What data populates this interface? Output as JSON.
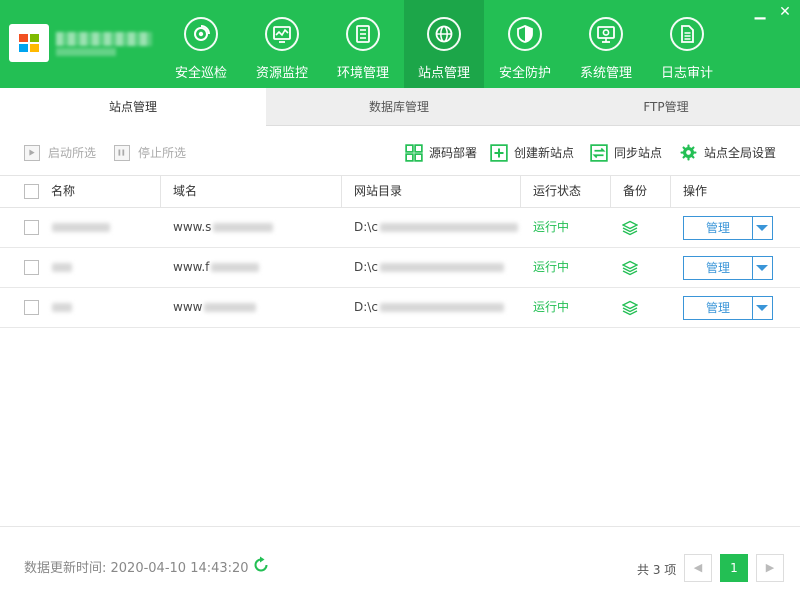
{
  "header": {
    "nav": [
      {
        "label": "安全巡检",
        "icon": "scan-icon"
      },
      {
        "label": "资源监控",
        "icon": "monitor-icon"
      },
      {
        "label": "环境管理",
        "icon": "server-icon"
      },
      {
        "label": "站点管理",
        "icon": "globe-icon",
        "active": true
      },
      {
        "label": "安全防护",
        "icon": "shield-icon"
      },
      {
        "label": "系统管理",
        "icon": "gear-screen-icon"
      },
      {
        "label": "日志审计",
        "icon": "document-icon"
      }
    ]
  },
  "tabs": [
    {
      "label": "站点管理",
      "active": true
    },
    {
      "label": "数据库管理"
    },
    {
      "label": "FTP管理"
    }
  ],
  "toolbar": {
    "start_selected": "启动所选",
    "stop_selected": "停止所选",
    "source_deploy": "源码部署",
    "create_site": "创建新站点",
    "sync_site": "同步站点",
    "global_settings": "站点全局设置"
  },
  "table": {
    "headers": [
      "名称",
      "域名",
      "网站目录",
      "运行状态",
      "备份",
      "操作"
    ],
    "rows": [
      {
        "domain_prefix": "www.s",
        "dir_prefix": "D:\\c",
        "status": "运行中",
        "action": "管理"
      },
      {
        "domain_prefix": "www.f",
        "dir_prefix": "D:\\c",
        "status": "运行中",
        "action": "管理"
      },
      {
        "domain_prefix": "www",
        "dir_prefix": "D:\\c",
        "status": "运行中",
        "action": "管理"
      }
    ]
  },
  "footer": {
    "update_label": "数据更新时间: 2020-04-10 14:43:20",
    "total_label": "共 3 项",
    "current_page": "1",
    "prev": "◀",
    "next": "▶"
  },
  "colors": {
    "brand": "#23bf54",
    "brand_active": "#1ca649",
    "link_blue": "#3a95d8"
  }
}
